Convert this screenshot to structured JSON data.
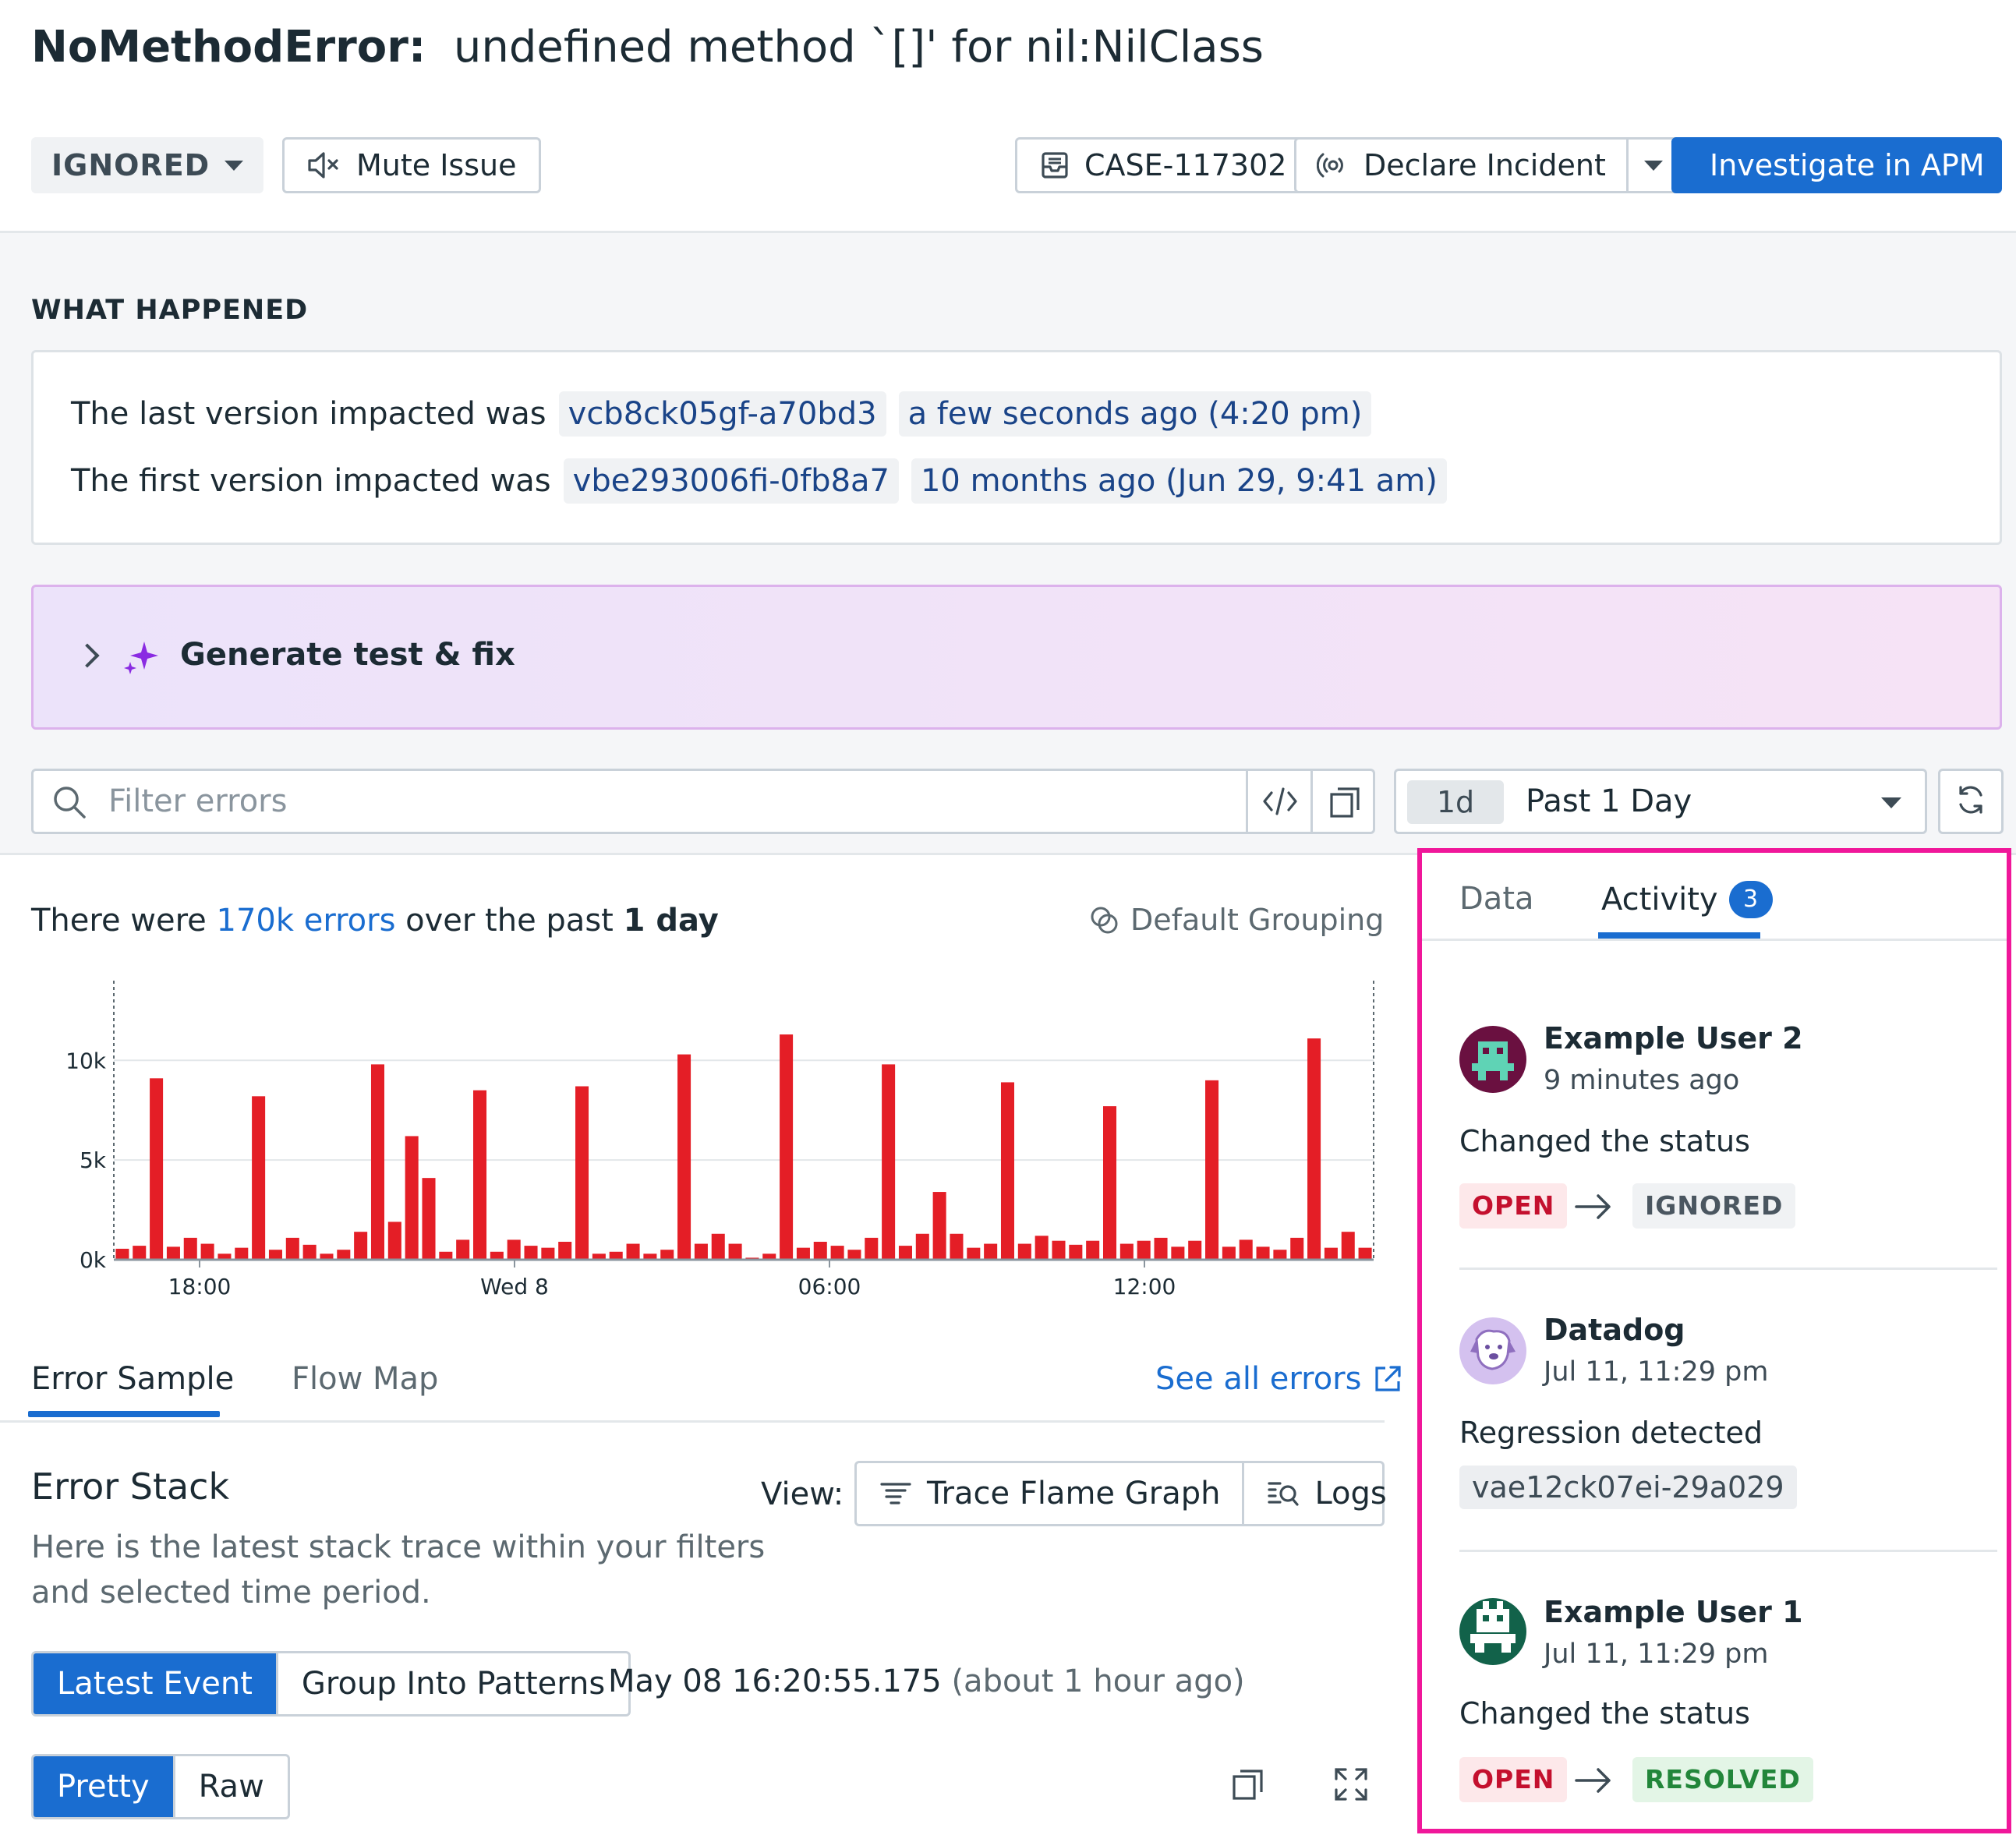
{
  "header": {
    "error_type": "NoMethodError:",
    "error_message": "undefined method `[]' for nil:NilClass",
    "status": "IGNORED",
    "mute_label": "Mute Issue",
    "case_label": "CASE-117302",
    "incident_label": "Declare Incident",
    "apm_label": "Investigate in APM"
  },
  "what_happened": {
    "heading": "WHAT HAPPENED",
    "last_prefix": "The last version impacted was",
    "last_version": "vcb8ck05gf-a70bd3",
    "last_time": "a few seconds ago (4:20 pm)",
    "first_prefix": "The first version impacted was",
    "first_version": "vbe293006fi-0fb8a7",
    "first_time": "10 months ago (Jun 29, 9:41 am)"
  },
  "generate": {
    "label": "Generate test & fix"
  },
  "filter": {
    "placeholder": "Filter errors",
    "time_chip": "1d",
    "time_label": "Past 1 Day"
  },
  "summary": {
    "prefix": "There were",
    "count": "170k errors",
    "middle": "over the past",
    "period": "1 day",
    "grouping": "Default Grouping"
  },
  "chart_data": {
    "type": "bar",
    "title": "",
    "xlabel": "",
    "ylabel": "",
    "ylim": [
      0,
      14000
    ],
    "yticks": [
      "0k",
      "5k",
      "10k"
    ],
    "x_ticks": [
      "18:00",
      "Wed 8",
      "06:00",
      "12:00"
    ],
    "color": "#e41e26",
    "values": [
      550,
      700,
      9100,
      650,
      1100,
      800,
      300,
      600,
      8200,
      500,
      1100,
      750,
      300,
      500,
      1400,
      9800,
      1900,
      6200,
      4100,
      400,
      1000,
      8500,
      400,
      1000,
      700,
      600,
      900,
      8700,
      300,
      400,
      800,
      300,
      500,
      10300,
      800,
      1300,
      800,
      100,
      300,
      11300,
      600,
      900,
      700,
      500,
      1100,
      9800,
      700,
      1300,
      3400,
      1300,
      600,
      800,
      8900,
      800,
      1200,
      950,
      750,
      950,
      7700,
      800,
      950,
      1100,
      650,
      950,
      9000,
      650,
      1000,
      650,
      500,
      1100,
      11100,
      600,
      1400,
      600
    ]
  },
  "tabs": {
    "error_sample": "Error Sample",
    "flow_map": "Flow Map",
    "see_all": "See all errors"
  },
  "stack": {
    "title": "Error Stack",
    "description": "Here is the latest stack trace within your filters and selected time period.",
    "view_label": "View:",
    "trace_flame_graph": "Trace Flame Graph",
    "logs": "Logs",
    "latest_event": "Latest Event",
    "group_patterns": "Group Into Patterns",
    "event_time": "May 08 16:20:55.175",
    "event_relative": "(about 1 hour ago)",
    "pretty": "Pretty",
    "raw": "Raw"
  },
  "panel": {
    "tab_data": "Data",
    "tab_activity": "Activity",
    "activity_count": "3",
    "items": [
      {
        "user": "Example User 2",
        "time": "9 minutes ago",
        "message": "Changed the status",
        "from": "OPEN",
        "to": "IGNORED"
      },
      {
        "user": "Datadog",
        "time": "Jul 11, 11:29 pm",
        "message": "Regression detected",
        "version": "vae12ck07ei-29a029"
      },
      {
        "user": "Example User 1",
        "time": "Jul 11, 11:29 pm",
        "message": "Changed the status",
        "from": "OPEN",
        "to": "RESOLVED"
      }
    ]
  }
}
